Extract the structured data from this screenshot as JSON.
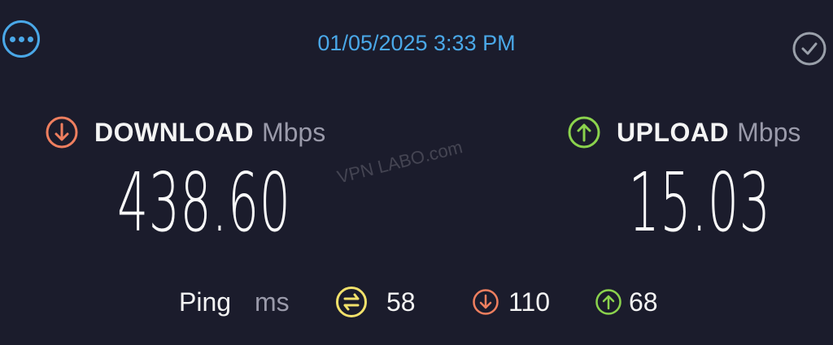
{
  "header": {
    "timestamp": "01/05/2025 3:33 PM"
  },
  "watermark": "VPN LABO.com",
  "download": {
    "label": "DOWNLOAD",
    "unit": "Mbps",
    "value": "438.60"
  },
  "upload": {
    "label": "UPLOAD",
    "unit": "Mbps",
    "value": "15.03"
  },
  "ping": {
    "label": "Ping",
    "unit": "ms",
    "idle": "58",
    "download": "110",
    "upload": "68"
  },
  "colors": {
    "background": "#1b1c2c",
    "accent_blue": "#4aa8e8",
    "download_orange": "#ef7f5f",
    "upload_green": "#8bd34d",
    "ping_yellow": "#f2e16b",
    "unit_gray": "#9a9aaa"
  },
  "icons": {
    "more": "more-horizontal-icon",
    "check": "check-circle-icon",
    "download": "arrow-down-circle-icon",
    "upload": "arrow-up-circle-icon",
    "ping_idle": "ping-idle-icon"
  }
}
